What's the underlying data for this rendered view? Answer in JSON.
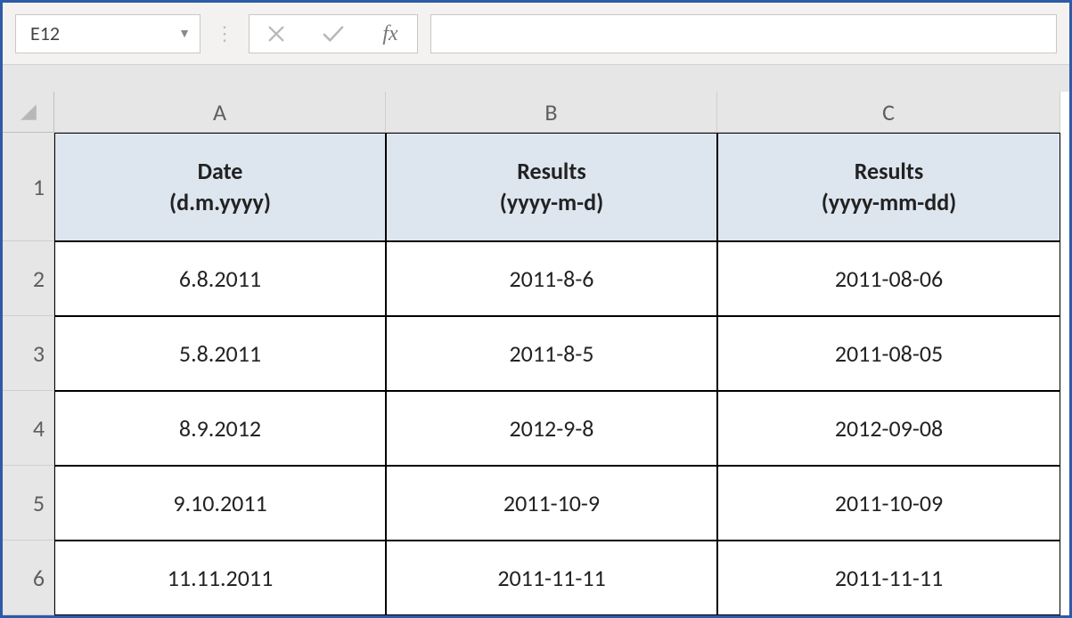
{
  "formula_bar": {
    "cell_reference": "E12",
    "fx_label": "fx",
    "formula_value": ""
  },
  "columns": [
    "A",
    "B",
    "C"
  ],
  "rows": [
    "1",
    "2",
    "3",
    "4",
    "5",
    "6"
  ],
  "table": {
    "headers": {
      "A": "Date\n(d.m.yyyy)",
      "B": "Results\n(yyyy-m-d)",
      "C": "Results\n(yyyy-mm-dd)"
    },
    "data": [
      {
        "A": "6.8.2011",
        "B": "2011-8-6",
        "C": "2011-08-06"
      },
      {
        "A": "5.8.2011",
        "B": "2011-8-5",
        "C": "2011-08-05"
      },
      {
        "A": "8.9.2012",
        "B": "2012-9-8",
        "C": "2012-09-08"
      },
      {
        "A": "9.10.2011",
        "B": "2011-10-9",
        "C": "2011-10-09"
      },
      {
        "A": "11.11.2011",
        "B": "2011-11-11",
        "C": "2011-11-11"
      }
    ]
  }
}
